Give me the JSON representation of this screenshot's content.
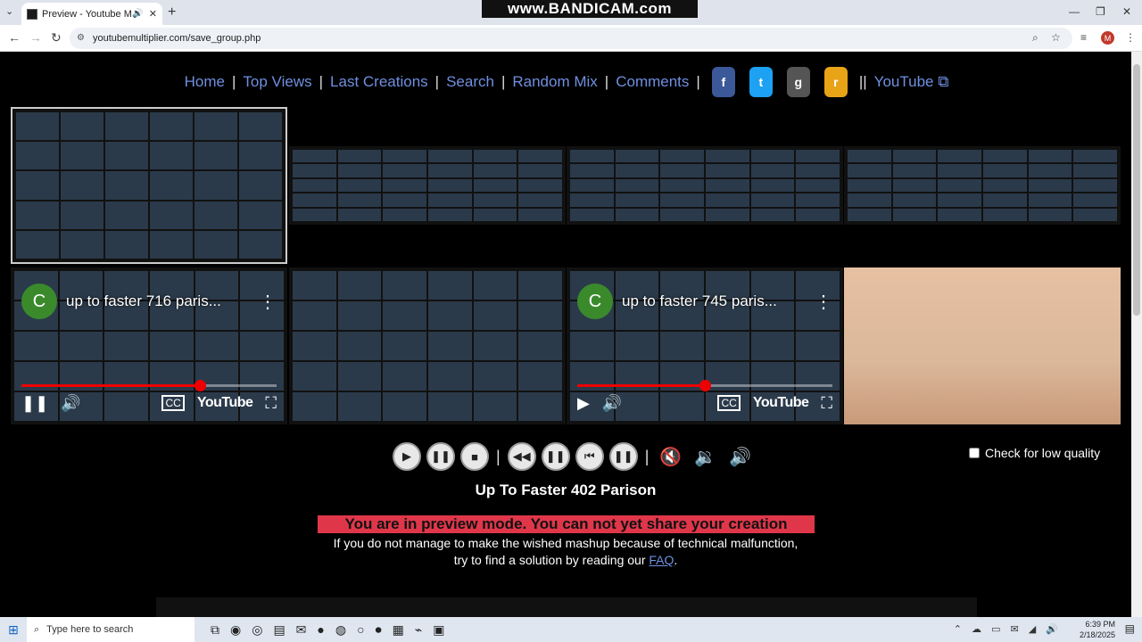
{
  "browser": {
    "tab_title": "Preview - Youtube Multiplie",
    "url": "youtubemultiplier.com/save_group.php",
    "recorder_watermark": "www.BANDICAM.com",
    "profile_initial": "M"
  },
  "site_nav": {
    "home": "Home",
    "top_views": "Top Views",
    "last_creations": "Last Creations",
    "search": "Search",
    "random_mix": "Random Mix",
    "comments": "Comments",
    "youtube": "YouTube"
  },
  "players": [
    {
      "title": "up to faster 716 paris...",
      "channel_initial": "C",
      "state": "playing",
      "progress": 0.7
    },
    {
      "title": "up to faster 745 paris...",
      "channel_initial": "C",
      "state": "paused",
      "progress": 0.5
    }
  ],
  "player_labels": {
    "youtube": "YouTube"
  },
  "controls": {
    "low_quality_label": "Check for low quality"
  },
  "playlist_title": "Up To Faster 402 Parison",
  "preview_message": "You are in preview mode. You can not yet share your creation",
  "info": {
    "line1": "If you do not manage to make the wished mashup because of technical malfunction,",
    "line2_prefix": "try to find a solution by reading our",
    "faq": "FAQ",
    "line2_suffix": "."
  },
  "taskbar": {
    "search_placeholder": "Type here to search",
    "time": "6:39 PM",
    "date": "2/18/2025"
  },
  "colors": {
    "link": "#6f8fe0",
    "preview_bg": "#e0364a",
    "progress": "#e00000"
  }
}
